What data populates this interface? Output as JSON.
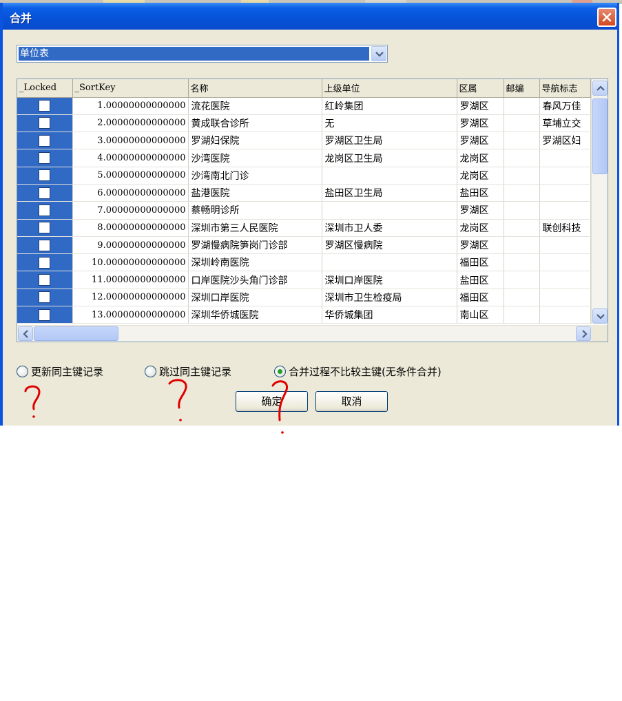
{
  "window": {
    "title": "合并"
  },
  "table_selector": {
    "value": "单位表"
  },
  "grid": {
    "columns": [
      "_Locked",
      "_SortKey",
      "名称",
      "上级单位",
      "区属",
      "邮编",
      "导航标志"
    ],
    "rows": [
      {
        "locked": false,
        "sort_key": "1.00000000000000",
        "name": "流花医院",
        "parent": "红岭集团",
        "district": "罗湖区",
        "postcode": "",
        "nav": "春风万佳"
      },
      {
        "locked": false,
        "sort_key": "2.00000000000000",
        "name": "黄成联合诊所",
        "parent": "无",
        "district": "罗湖区",
        "postcode": "",
        "nav": "草埔立交"
      },
      {
        "locked": false,
        "sort_key": "3.00000000000000",
        "name": "罗湖妇保院",
        "parent": "罗湖区卫生局",
        "district": "罗湖区",
        "postcode": "",
        "nav": "罗湖区妇"
      },
      {
        "locked": false,
        "sort_key": "4.00000000000000",
        "name": "沙湾医院",
        "parent": "龙岗区卫生局",
        "district": "龙岗区",
        "postcode": "",
        "nav": ""
      },
      {
        "locked": false,
        "sort_key": "5.00000000000000",
        "name": "沙湾南北门诊",
        "parent": "",
        "district": "龙岗区",
        "postcode": "",
        "nav": ""
      },
      {
        "locked": false,
        "sort_key": "6.00000000000000",
        "name": "盐港医院",
        "parent": "盐田区卫生局",
        "district": "盐田区",
        "postcode": "",
        "nav": ""
      },
      {
        "locked": false,
        "sort_key": "7.00000000000000",
        "name": "蔡畅明诊所",
        "parent": "",
        "district": "罗湖区",
        "postcode": "",
        "nav": ""
      },
      {
        "locked": false,
        "sort_key": "8.00000000000000",
        "name": "深圳市第三人民医院",
        "parent": "深圳市卫人委",
        "district": "龙岗区",
        "postcode": "",
        "nav": "联创科技"
      },
      {
        "locked": false,
        "sort_key": "9.00000000000000",
        "name": "罗湖慢病院笋岗门诊部",
        "parent": "罗湖区慢病院",
        "district": "罗湖区",
        "postcode": "",
        "nav": ""
      },
      {
        "locked": false,
        "sort_key": "10.00000000000000",
        "name": "深圳岭南医院",
        "parent": "",
        "district": "福田区",
        "postcode": "",
        "nav": ""
      },
      {
        "locked": false,
        "sort_key": "11.00000000000000",
        "name": "口岸医院沙头角门诊部",
        "parent": "深圳口岸医院",
        "district": "盐田区",
        "postcode": "",
        "nav": ""
      },
      {
        "locked": false,
        "sort_key": "12.00000000000000",
        "name": "深圳口岸医院",
        "parent": "深圳市卫生检疫局",
        "district": "福田区",
        "postcode": "",
        "nav": ""
      },
      {
        "locked": false,
        "sort_key": "13.00000000000000",
        "name": "深圳华侨城医院",
        "parent": "华侨城集团",
        "district": "南山区",
        "postcode": "",
        "nav": ""
      }
    ]
  },
  "options": {
    "update_label": "更新同主键记录",
    "skip_label": "跳过同主键记录",
    "merge_label": "合并过程不比较主键(无条件合并)",
    "selected": "merge"
  },
  "buttons": {
    "ok": "确定",
    "cancel": "取消"
  },
  "colors": {
    "title_bar": "#0a5fe6",
    "selection": "#316ac5",
    "dialog_bg": "#ece9d8",
    "annotation": "#e00000"
  },
  "icons": [
    "close-icon",
    "dropdown-arrow-icon",
    "scroll-up-icon",
    "scroll-down-icon",
    "scroll-left-icon",
    "scroll-right-icon"
  ]
}
